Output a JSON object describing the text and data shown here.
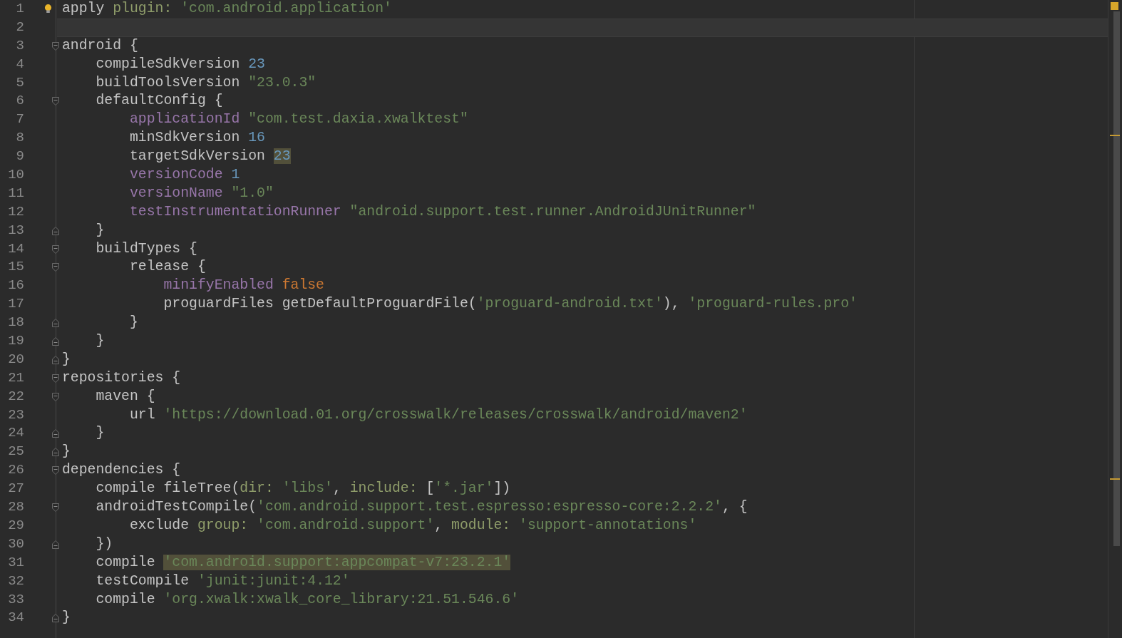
{
  "lines": [
    {
      "number": "1",
      "fold_start": false,
      "fold_end": false,
      "current": false,
      "hint": true,
      "tokens": [
        {
          "kind": "text",
          "text": "apply "
        },
        {
          "kind": "named",
          "text": "plugin: "
        },
        {
          "kind": "string",
          "text": "'com.android.application'"
        }
      ]
    },
    {
      "number": "2",
      "fold_start": false,
      "fold_end": false,
      "current": true,
      "hint": false
    },
    {
      "number": "3",
      "fold_start": true,
      "fold_end": false,
      "current": false,
      "hint": false,
      "tokens": [
        {
          "kind": "text",
          "text": "android {"
        }
      ]
    },
    {
      "number": "4",
      "fold_start": false,
      "fold_end": false,
      "current": false,
      "hint": false,
      "tokens": [
        {
          "kind": "text",
          "text": "    compileSdkVersion "
        },
        {
          "kind": "number",
          "text": "23"
        }
      ]
    },
    {
      "number": "5",
      "fold_start": false,
      "fold_end": false,
      "current": false,
      "hint": false,
      "tokens": [
        {
          "kind": "text",
          "text": "    buildToolsVersion "
        },
        {
          "kind": "string",
          "text": "\"23.0.3\""
        }
      ]
    },
    {
      "number": "6",
      "fold_start": true,
      "fold_end": false,
      "current": false,
      "hint": false,
      "tokens": [
        {
          "kind": "text",
          "text": "    defaultConfig {"
        }
      ]
    },
    {
      "number": "7",
      "fold_start": false,
      "fold_end": false,
      "current": false,
      "hint": false,
      "tokens": [
        {
          "kind": "property",
          "text": "        applicationId "
        },
        {
          "kind": "string",
          "text": "\"com.test.daxia.xwalktest\""
        }
      ]
    },
    {
      "number": "8",
      "fold_start": false,
      "fold_end": false,
      "current": false,
      "hint": false,
      "tokens": [
        {
          "kind": "text",
          "text": "        minSdkVersion "
        },
        {
          "kind": "number",
          "text": "16"
        }
      ]
    },
    {
      "number": "9",
      "fold_start": false,
      "fold_end": false,
      "current": false,
      "hint": false,
      "tokens": [
        {
          "kind": "text",
          "text": "        targetSdkVersion "
        },
        {
          "kind": "number",
          "text": "23",
          "highlighted": true
        }
      ]
    },
    {
      "number": "10",
      "fold_start": false,
      "fold_end": false,
      "current": false,
      "hint": false,
      "tokens": [
        {
          "kind": "property",
          "text": "        versionCode "
        },
        {
          "kind": "number",
          "text": "1"
        }
      ]
    },
    {
      "number": "11",
      "fold_start": false,
      "fold_end": false,
      "current": false,
      "hint": false,
      "tokens": [
        {
          "kind": "property",
          "text": "        versionName "
        },
        {
          "kind": "string",
          "text": "\"1.0\""
        }
      ]
    },
    {
      "number": "12",
      "fold_start": false,
      "fold_end": false,
      "current": false,
      "hint": false,
      "tokens": [
        {
          "kind": "property",
          "text": "        testInstrumentationRunner "
        },
        {
          "kind": "string",
          "text": "\"android.support.test.runner.AndroidJUnitRunner\""
        }
      ]
    },
    {
      "number": "13",
      "fold_start": false,
      "fold_end": true,
      "current": false,
      "hint": false,
      "tokens": [
        {
          "kind": "text",
          "text": "    }"
        }
      ]
    },
    {
      "number": "14",
      "fold_start": true,
      "fold_end": false,
      "current": false,
      "hint": false,
      "tokens": [
        {
          "kind": "text",
          "text": "    buildTypes {"
        }
      ]
    },
    {
      "number": "15",
      "fold_start": true,
      "fold_end": false,
      "current": false,
      "hint": false,
      "tokens": [
        {
          "kind": "text",
          "text": "        release {"
        }
      ]
    },
    {
      "number": "16",
      "fold_start": false,
      "fold_end": false,
      "current": false,
      "hint": false,
      "tokens": [
        {
          "kind": "property",
          "text": "            minifyEnabled "
        },
        {
          "kind": "keyword",
          "text": "false"
        }
      ]
    },
    {
      "number": "17",
      "fold_start": false,
      "fold_end": false,
      "current": false,
      "hint": false,
      "tokens": [
        {
          "kind": "text",
          "text": "            proguardFiles getDefaultProguardFile("
        },
        {
          "kind": "string",
          "text": "'proguard-android.txt'"
        },
        {
          "kind": "text",
          "text": "), "
        },
        {
          "kind": "string",
          "text": "'proguard-rules.pro'"
        }
      ]
    },
    {
      "number": "18",
      "fold_start": false,
      "fold_end": true,
      "current": false,
      "hint": false,
      "tokens": [
        {
          "kind": "text",
          "text": "        }"
        }
      ]
    },
    {
      "number": "19",
      "fold_start": false,
      "fold_end": true,
      "current": false,
      "hint": false,
      "tokens": [
        {
          "kind": "text",
          "text": "    }"
        }
      ]
    },
    {
      "number": "20",
      "fold_start": false,
      "fold_end": true,
      "current": false,
      "hint": false,
      "tokens": [
        {
          "kind": "text",
          "text": "}"
        }
      ]
    },
    {
      "number": "21",
      "fold_start": true,
      "fold_end": false,
      "current": false,
      "hint": false,
      "tokens": [
        {
          "kind": "text",
          "text": "repositories {"
        }
      ]
    },
    {
      "number": "22",
      "fold_start": true,
      "fold_end": false,
      "current": false,
      "hint": false,
      "tokens": [
        {
          "kind": "text",
          "text": "    maven {"
        }
      ]
    },
    {
      "number": "23",
      "fold_start": false,
      "fold_end": false,
      "current": false,
      "hint": false,
      "tokens": [
        {
          "kind": "text",
          "text": "        url "
        },
        {
          "kind": "string",
          "text": "'https://download.01.org/crosswalk/releases/crosswalk/android/maven2'"
        }
      ]
    },
    {
      "number": "24",
      "fold_start": false,
      "fold_end": true,
      "current": false,
      "hint": false,
      "tokens": [
        {
          "kind": "text",
          "text": "    }"
        }
      ]
    },
    {
      "number": "25",
      "fold_start": false,
      "fold_end": true,
      "current": false,
      "hint": false,
      "tokens": [
        {
          "kind": "text",
          "text": "}"
        }
      ]
    },
    {
      "number": "26",
      "fold_start": true,
      "fold_end": false,
      "current": false,
      "hint": false,
      "tokens": [
        {
          "kind": "text",
          "text": "dependencies {"
        }
      ]
    },
    {
      "number": "27",
      "fold_start": false,
      "fold_end": false,
      "current": false,
      "hint": false,
      "tokens": [
        {
          "kind": "text",
          "text": "    compile fileTree("
        },
        {
          "kind": "named",
          "text": "dir: "
        },
        {
          "kind": "string",
          "text": "'libs'"
        },
        {
          "kind": "text",
          "text": ", "
        },
        {
          "kind": "named",
          "text": "include: "
        },
        {
          "kind": "text",
          "text": "["
        },
        {
          "kind": "string",
          "text": "'*.jar'"
        },
        {
          "kind": "text",
          "text": "])"
        }
      ]
    },
    {
      "number": "28",
      "fold_start": true,
      "fold_end": false,
      "current": false,
      "hint": false,
      "tokens": [
        {
          "kind": "text",
          "text": "    androidTestCompile("
        },
        {
          "kind": "string",
          "text": "'com.android.support.test.espresso:espresso-core:2.2.2'"
        },
        {
          "kind": "text",
          "text": ", {"
        }
      ]
    },
    {
      "number": "29",
      "fold_start": false,
      "fold_end": false,
      "current": false,
      "hint": false,
      "tokens": [
        {
          "kind": "text",
          "text": "        exclude "
        },
        {
          "kind": "named",
          "text": "group: "
        },
        {
          "kind": "string",
          "text": "'com.android.support'"
        },
        {
          "kind": "text",
          "text": ", "
        },
        {
          "kind": "named",
          "text": "module: "
        },
        {
          "kind": "string",
          "text": "'support-annotations'"
        }
      ]
    },
    {
      "number": "30",
      "fold_start": false,
      "fold_end": true,
      "current": false,
      "hint": false,
      "tokens": [
        {
          "kind": "text",
          "text": "    })"
        }
      ]
    },
    {
      "number": "31",
      "fold_start": false,
      "fold_end": false,
      "current": false,
      "hint": false,
      "tokens": [
        {
          "kind": "text",
          "text": "    compile "
        },
        {
          "kind": "string",
          "text": "'com.android.support:appcompat-v7:23.2.1'",
          "highlighted": true
        }
      ]
    },
    {
      "number": "32",
      "fold_start": false,
      "fold_end": false,
      "current": false,
      "hint": false,
      "tokens": [
        {
          "kind": "text",
          "text": "    testCompile "
        },
        {
          "kind": "string",
          "text": "'junit:junit:4.12'"
        }
      ]
    },
    {
      "number": "33",
      "fold_start": false,
      "fold_end": false,
      "current": false,
      "hint": false,
      "tokens": [
        {
          "kind": "text",
          "text": "    compile "
        },
        {
          "kind": "string",
          "text": "'org.xwalk:xwalk_core_library:21.51.546.6'"
        }
      ]
    },
    {
      "number": "34",
      "fold_start": false,
      "fold_end": true,
      "current": false,
      "hint": false,
      "tokens": [
        {
          "kind": "text",
          "text": "}"
        }
      ]
    }
  ]
}
